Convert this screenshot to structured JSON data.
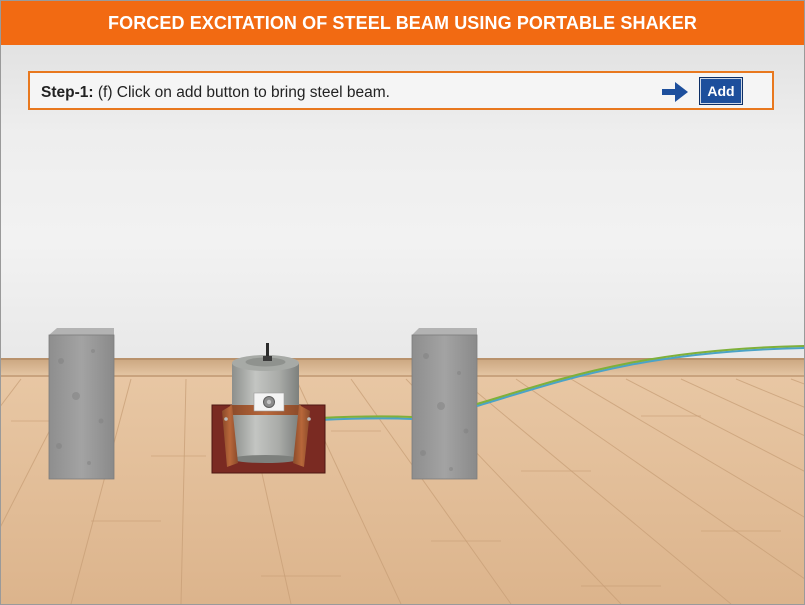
{
  "header": {
    "title": "FORCED EXCITATION OF STEEL BEAM USING PORTABLE SHAKER"
  },
  "instruction": {
    "step_label": "Step-1:",
    "text": " (f) Click on add button to bring steel beam.",
    "arrow_icon": "arrow-right-icon",
    "add_label": "Add"
  },
  "colors": {
    "header": "#f26a12",
    "instruction_border": "#e8781e",
    "add_button": "#1d4f9c",
    "arrow": "#1d4f9c",
    "floor": "#e3bf9a",
    "concrete_block": "#9b9b9b",
    "shaker_base": "#7a2a22",
    "cable_green": "#7fb03a",
    "cable_blue": "#4ba3c7"
  },
  "scene": {
    "objects": [
      "left-concrete-support",
      "portable-shaker",
      "right-concrete-support",
      "excitation-cable"
    ]
  }
}
